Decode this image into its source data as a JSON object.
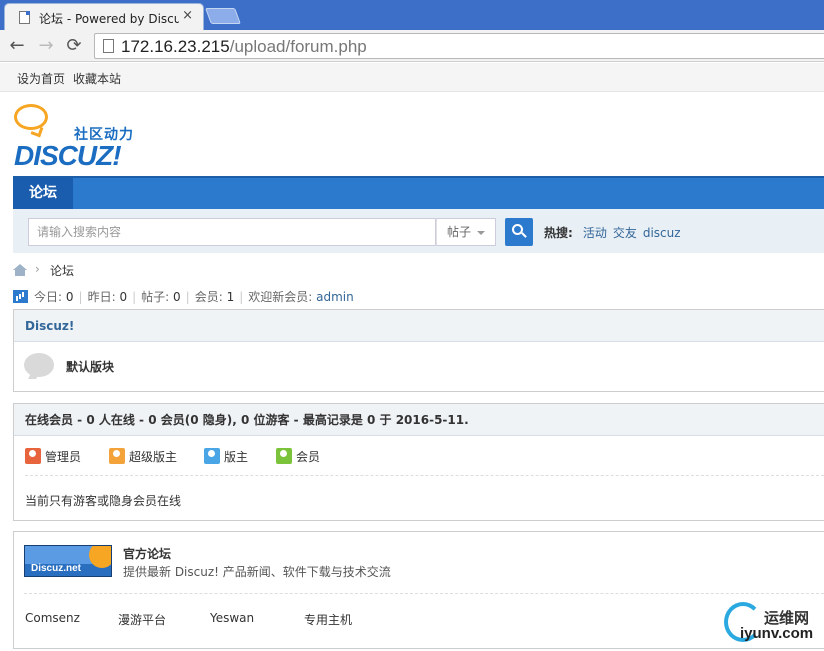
{
  "browser": {
    "tab_title": "论坛 - Powered by Discuz!",
    "tab_close": "×",
    "url_host": "172.16.23.215",
    "url_path": "/upload/forum.php",
    "nav": {
      "back": "←",
      "forward": "→",
      "reload": "⟳"
    }
  },
  "toplinks": [
    "设为首页",
    "收藏本站"
  ],
  "logo": {
    "tagline": "社区动力",
    "brand": "DISCUZ!"
  },
  "nav": {
    "active": "论坛"
  },
  "search": {
    "placeholder": "请输入搜索内容",
    "type": "帖子",
    "hot_label": "热搜:",
    "hot_terms": [
      "活动",
      "交友",
      "discuz"
    ]
  },
  "breadcrumb": {
    "sep": "›",
    "current": "论坛"
  },
  "stats": {
    "today_label": "今日:",
    "today": "0",
    "yesterday_label": "昨日:",
    "yesterday": "0",
    "posts_label": "帖子:",
    "posts": "0",
    "members_label": "会员:",
    "members": "1",
    "welcome_label": "欢迎新会员:",
    "newest_member": "admin",
    "sep": "|"
  },
  "forum_group": {
    "title": "Discuz!",
    "forum_name": "默认版块"
  },
  "online": {
    "title": "在线会员 - 0 人在线 - 0 会员(0 隐身), 0 位游客 - 最高记录是 0 于 2016-5-11.",
    "legend": [
      {
        "label": "管理员",
        "color": "#e8643c"
      },
      {
        "label": "超级版主",
        "color": "#f3a33a"
      },
      {
        "label": "版主",
        "color": "#4aa5e6"
      },
      {
        "label": "会员",
        "color": "#7cc33c"
      }
    ],
    "note": "当前只有游客或隐身会员在线"
  },
  "official": {
    "logo_text": "Discuz.net",
    "title": "官方论坛",
    "desc": "提供最新 Discuz! 产品新闻、软件下载与技术交流",
    "links": [
      "Comsenz",
      "漫游平台",
      "Yeswan",
      "专用主机"
    ]
  },
  "watermark": {
    "cn": "运维网",
    "en": "iyunv.com"
  }
}
